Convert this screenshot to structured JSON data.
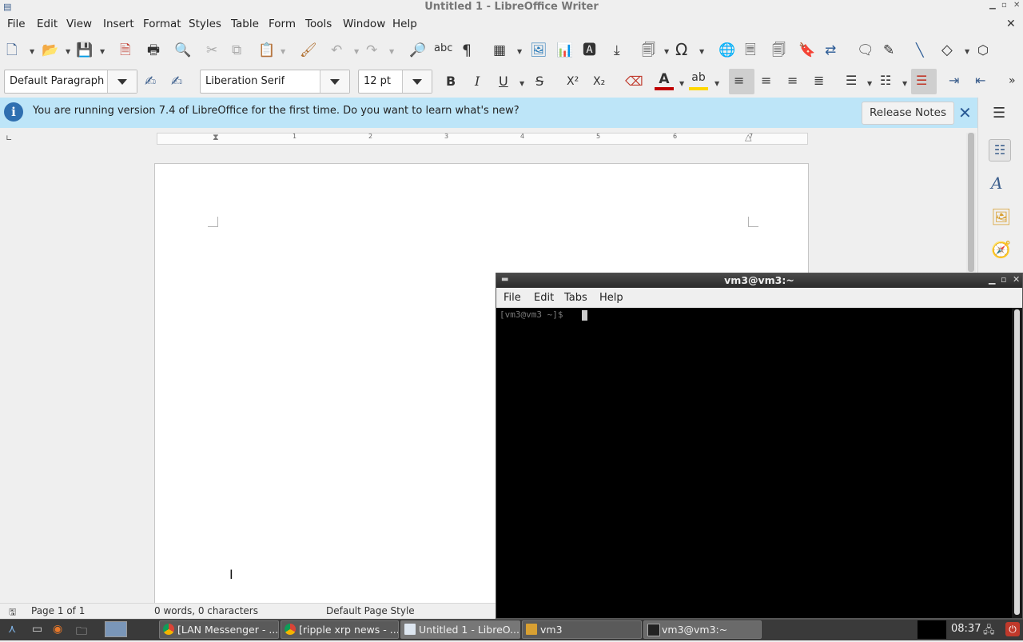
{
  "window": {
    "title": "Untitled 1 - LibreOffice Writer"
  },
  "menubar": {
    "items": [
      "File",
      "Edit",
      "View",
      "Insert",
      "Format",
      "Styles",
      "Table",
      "Form",
      "Tools",
      "Window",
      "Help"
    ]
  },
  "toolbar": {
    "paragraph_style": "Default Paragraph S",
    "font_name": "Liberation Serif",
    "font_size": "12 pt",
    "bold": "B",
    "italic": "I",
    "underline": "U",
    "strikethrough": "S",
    "superscript": "X²",
    "subscript": "X₂"
  },
  "infobar": {
    "message": "You are running version 7.4 of LibreOffice for the first time. Do you want to learn what's new?",
    "button": "Release Notes"
  },
  "ruler": {
    "numbers": [
      "1",
      "2",
      "3",
      "4",
      "5",
      "6",
      "7"
    ]
  },
  "statusbar": {
    "page": "Page 1 of 1",
    "words": "0 words, 0 characters",
    "page_style": "Default Page Style"
  },
  "terminal": {
    "title": "vm3@vm3:~",
    "menu": [
      "File",
      "Edit",
      "Tabs",
      "Help"
    ],
    "prompt": "[vm3@vm3 ~]$"
  },
  "taskbar": {
    "tasks": [
      "[LAN Messenger - ...",
      "[ripple xrp news - ...",
      "Untitled 1 - LibreO...",
      "vm3",
      "vm3@vm3:~"
    ],
    "clock": "08:37"
  },
  "colors": {
    "accent": "#3b5e8c",
    "infobar": "#bde5f8",
    "font_color": "#c00000",
    "highlight": "#ffd700"
  }
}
